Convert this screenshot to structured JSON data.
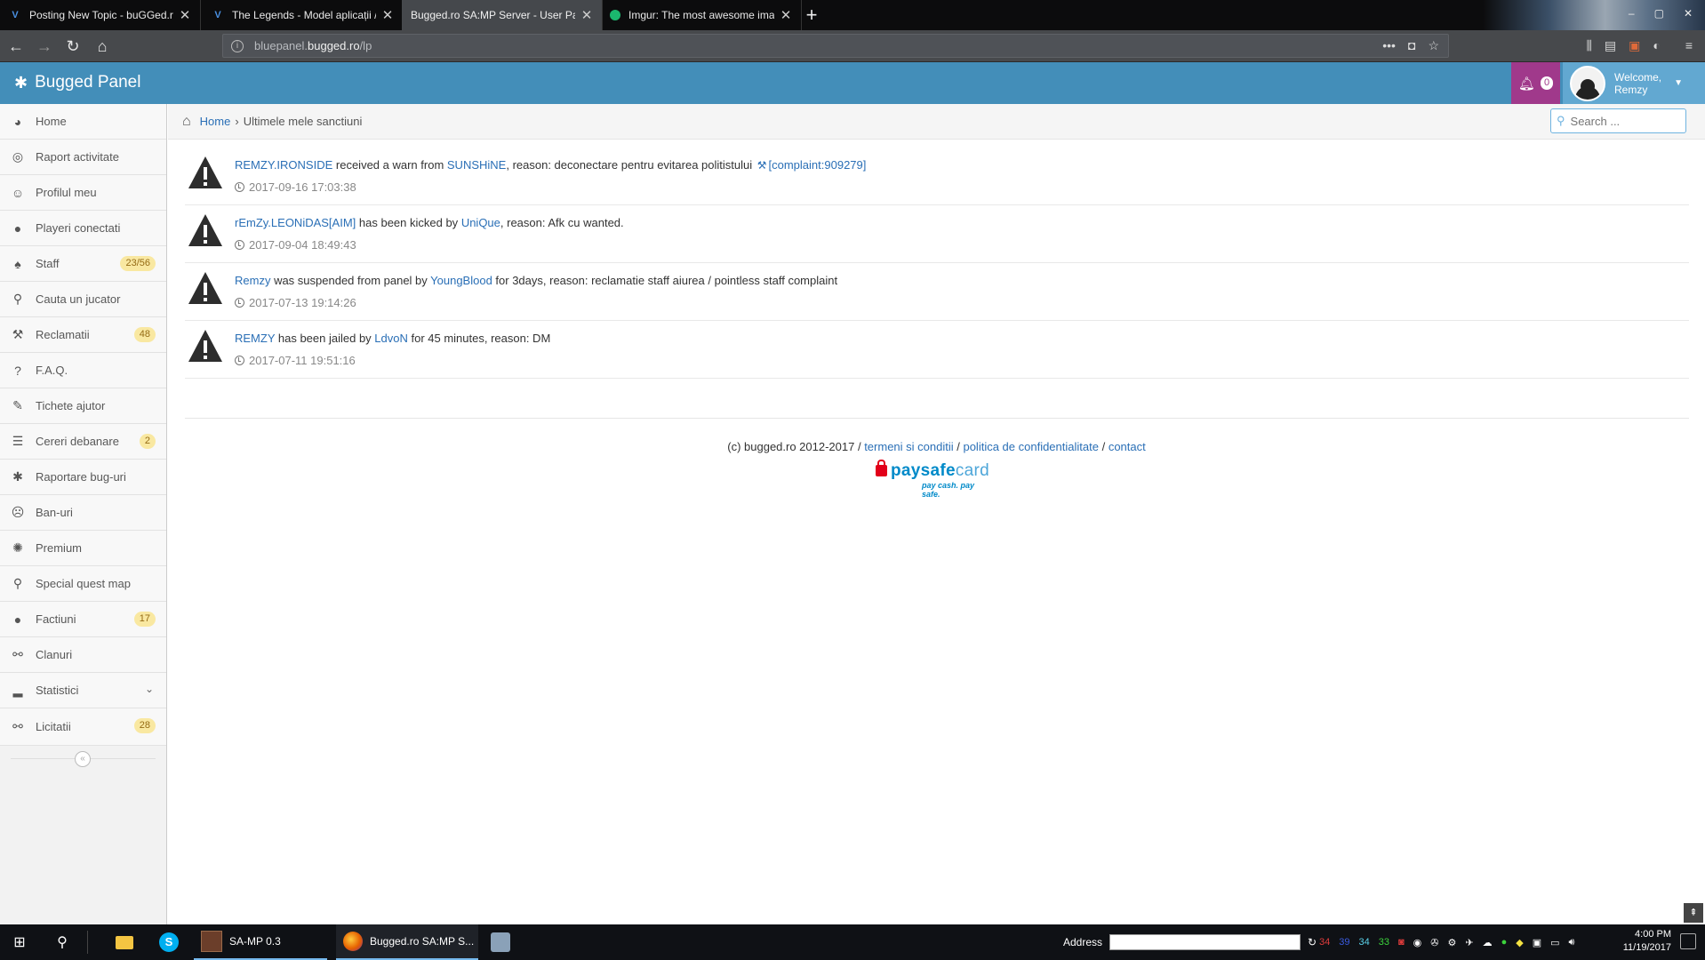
{
  "browser": {
    "tabs": [
      {
        "title": "Posting New Topic - buGGed.ro",
        "active": false
      },
      {
        "title": "The Legends - Model aplicații / ",
        "active": false
      },
      {
        "title": "Bugged.ro SA:MP Server - User Pan",
        "active": true
      },
      {
        "title": "Imgur: The most awesome ima",
        "active": false
      }
    ],
    "url_prefix": "bluepanel.",
    "url_domain": "bugged.ro",
    "url_path": "/lp"
  },
  "header": {
    "brand": "Bugged Panel",
    "notification_count": "0",
    "welcome": "Welcome,",
    "username": "Remzy",
    "accent": "#438eb9"
  },
  "sidebar": {
    "items": [
      {
        "label": "Home",
        "icon": "dashboard-icon"
      },
      {
        "label": "Raport activitate",
        "icon": "bullseye-icon"
      },
      {
        "label": "Profilul meu",
        "icon": "smile-icon"
      },
      {
        "label": "Playeri conectati",
        "icon": "user-icon"
      },
      {
        "label": "Staff",
        "icon": "android-icon",
        "badge": "23/56"
      },
      {
        "label": "Cauta un jucator",
        "icon": "search-icon"
      },
      {
        "label": "Reclamatii",
        "icon": "gavel-icon",
        "badge": "48"
      },
      {
        "label": "F.A.Q.",
        "icon": "question-icon"
      },
      {
        "label": "Tichete ajutor",
        "icon": "ticket-icon"
      },
      {
        "label": "Cereri debanare",
        "icon": "list-icon",
        "badge": "2"
      },
      {
        "label": "Raportare bug-uri",
        "icon": "bug-icon"
      },
      {
        "label": "Ban-uri",
        "icon": "frown-icon"
      },
      {
        "label": "Premium",
        "icon": "certificate-icon"
      },
      {
        "label": "Special quest map",
        "icon": "map-marker-icon"
      },
      {
        "label": "Factiuni",
        "icon": "users-icon",
        "badge": "17"
      },
      {
        "label": "Clanuri",
        "icon": "sitemap-icon"
      },
      {
        "label": "Statistici",
        "icon": "signal-icon"
      },
      {
        "label": "Licitatii",
        "icon": "sitemap-icon",
        "badge": "28"
      }
    ]
  },
  "breadcrumb": {
    "home": "Home",
    "current": "Ultimele mele sanctiuni"
  },
  "search": {
    "placeholder": "Search ..."
  },
  "sanctions": [
    {
      "player": "REMZY.IRONSIDE",
      "action": " received a warn from ",
      "admin": "SUNSHiNE",
      "rest": ", reason: deconectare pentru evitarea politistului ",
      "complaint": "[complaint:909279]",
      "time": "2017-09-16 17:03:38"
    },
    {
      "player": "rEmZy.LEONiDAS[AIM]",
      "action": " has been kicked by ",
      "admin": "UniQue",
      "rest": ", reason: Afk cu wanted.",
      "complaint": "",
      "time": "2017-09-04 18:49:43"
    },
    {
      "player": "Remzy",
      "action": " was suspended from panel by ",
      "admin": "YoungBlood",
      "rest": " for 3days, reason: reclamatie staff aiurea / pointless staff complaint",
      "complaint": "",
      "time": "2017-07-13 19:14:26"
    },
    {
      "player": "REMZY",
      "action": " has been jailed by ",
      "admin": "LdvoN",
      "rest": " for 45 minutes, reason: DM",
      "complaint": "",
      "time": "2017-07-11 19:51:16"
    }
  ],
  "footer": {
    "copyright": "(c) bugged.ro 2012-2017 / ",
    "terms": "termeni si conditii",
    "sep1": " / ",
    "privacy": "politica de confidentialitate",
    "sep2": " / ",
    "contact": "contact",
    "paysafe_main": "paysafe",
    "paysafe_card": "card",
    "paysafe_tag": "pay cash. pay safe."
  },
  "taskbar": {
    "apps": [
      {
        "label": "SA-MP 0.3"
      },
      {
        "label": "Bugged.ro SA:MP S..."
      }
    ],
    "address_label": "Address",
    "tray_numbers": [
      "34",
      "39",
      "34",
      "33"
    ],
    "time": "4:00 PM",
    "date": "11/19/2017"
  }
}
